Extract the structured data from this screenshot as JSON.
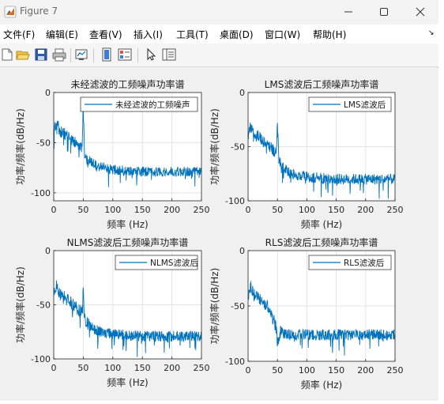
{
  "window": {
    "title": "Figure 7"
  },
  "menu": [
    "文件(F)",
    "编辑(E)",
    "查看(V)",
    "插入(I)",
    "工具(T)",
    "桌面(D)",
    "窗口(W)",
    "帮助(H)"
  ],
  "toolbar_icons": [
    "new-figure-icon",
    "open-file-icon",
    "save-icon",
    "print-icon",
    "link-plot-icon",
    "hide-plot-tools-icon",
    "show-plot-tools-icon",
    "pointer-icon",
    "property-editor-icon"
  ],
  "colors": {
    "line": "#0072bd"
  },
  "chart_data": [
    {
      "type": "line",
      "title": "未经滤波的工频噪声功率谱",
      "xlabel": "频率 (Hz)",
      "ylabel": "功率/频率(dB/Hz)",
      "xlim": [
        0,
        250
      ],
      "ylim": [
        -108,
        0
      ],
      "xticks": [
        "0",
        "50",
        "100",
        "150",
        "200",
        "250"
      ],
      "yticks": [
        "0",
        "-50",
        "-100"
      ],
      "legend": "未经滤波的工频噪声",
      "legend_position": "top-right",
      "series": [
        {
          "name": "未经滤波的工频噪声",
          "x": [
            0,
            5,
            10,
            20,
            30,
            40,
            48,
            50,
            52,
            55,
            60,
            70,
            80,
            100,
            150,
            200,
            250
          ],
          "y": [
            -40,
            -30,
            -38,
            -42,
            -46,
            -52,
            -55,
            -14,
            -60,
            -65,
            -68,
            -72,
            -74,
            -77,
            -79,
            -79,
            -79
          ]
        }
      ],
      "spike_x": 50,
      "spike_y": -14
    },
    {
      "type": "line",
      "title": "LMS滤波后工频噪声功率谱",
      "xlabel": "频率 (Hz)",
      "ylabel": "功率/频率(dB/Hz)",
      "xlim": [
        0,
        250
      ],
      "ylim": [
        -100,
        0
      ],
      "xticks": [
        "0",
        "50",
        "100",
        "150",
        "200",
        "250"
      ],
      "yticks": [
        "0",
        "-50",
        "-100"
      ],
      "legend": "LMS滤波后",
      "legend_position": "top-right",
      "series": [
        {
          "name": "LMS滤波后",
          "x": [
            0,
            5,
            10,
            20,
            30,
            40,
            48,
            50,
            52,
            55,
            60,
            70,
            80,
            100,
            150,
            200,
            250
          ],
          "y": [
            -40,
            -30,
            -38,
            -42,
            -46,
            -52,
            -55,
            -28,
            -60,
            -66,
            -70,
            -74,
            -76,
            -78,
            -80,
            -80,
            -80
          ]
        }
      ],
      "spike_x": 50,
      "spike_y": -28
    },
    {
      "type": "line",
      "title": "NLMS滤波后工频噪声功率谱",
      "xlabel": "频率 (Hz)",
      "ylabel": "功率/频率(dB/Hz)",
      "xlim": [
        0,
        250
      ],
      "ylim": [
        -100,
        0
      ],
      "xticks": [
        "0",
        "50",
        "100",
        "150",
        "200",
        "250"
      ],
      "yticks": [
        "0",
        "-50",
        "-100"
      ],
      "legend": "NLMS滤波后",
      "legend_position": "top-right",
      "series": [
        {
          "name": "NLMS滤波后",
          "x": [
            0,
            5,
            10,
            20,
            30,
            40,
            48,
            50,
            52,
            55,
            60,
            70,
            80,
            100,
            150,
            200,
            250
          ],
          "y": [
            -42,
            -32,
            -40,
            -44,
            -48,
            -54,
            -57,
            -34,
            -60,
            -65,
            -69,
            -73,
            -75,
            -77,
            -79,
            -79,
            -79
          ]
        }
      ],
      "spike_x": 50,
      "spike_y": -34
    },
    {
      "type": "line",
      "title": "RLS滤波后工频噪声功率谱",
      "xlabel": "频率 (Hz)",
      "ylabel": "功率/频率(dB/Hz)",
      "xlim": [
        0,
        250
      ],
      "ylim": [
        -100,
        0
      ],
      "xticks": [
        "0",
        "50",
        "100",
        "150",
        "200",
        "250"
      ],
      "yticks": [
        "0",
        "-50",
        "-100"
      ],
      "legend": "RLS滤波后",
      "legend_position": "top-right",
      "series": [
        {
          "name": "RLS滤波后",
          "x": [
            0,
            5,
            10,
            20,
            30,
            40,
            48,
            50,
            52,
            55,
            60,
            70,
            80,
            100,
            150,
            200,
            250
          ],
          "y": [
            -42,
            -32,
            -40,
            -44,
            -48,
            -56,
            -70,
            -82,
            -84,
            -74,
            -75,
            -76,
            -76,
            -76,
            -76,
            -76,
            -76
          ]
        }
      ],
      "spike_x": null,
      "spike_y": null
    }
  ]
}
